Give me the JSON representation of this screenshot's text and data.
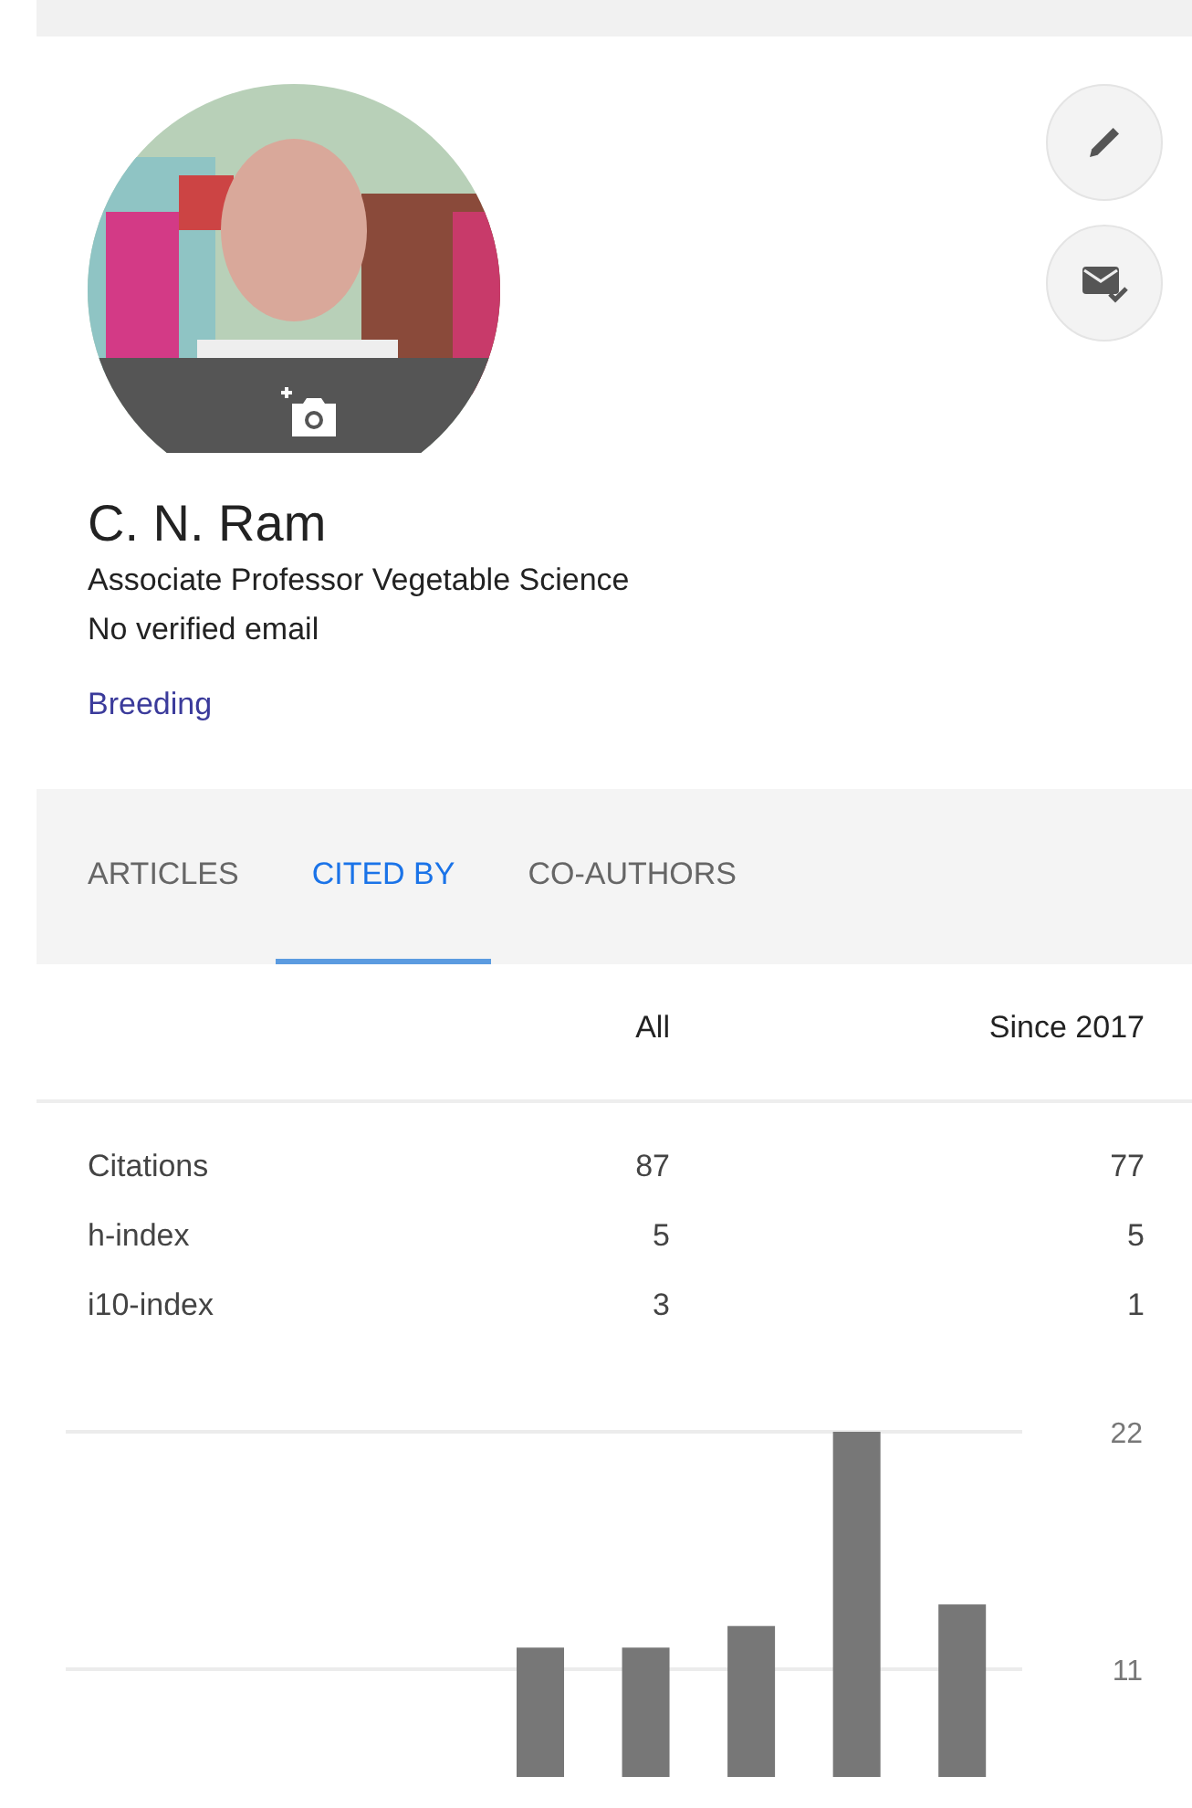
{
  "profile": {
    "name": "C. N. Ram",
    "affiliation": "Associate Professor Vegetable Science",
    "email_status": "No verified email",
    "interests": [
      "Breeding"
    ]
  },
  "tabs": [
    {
      "label": "ARTICLES",
      "selected": false
    },
    {
      "label": "CITED BY",
      "selected": true
    },
    {
      "label": "CO-AUTHORS",
      "selected": false
    }
  ],
  "citations": {
    "columns": [
      "All",
      "Since 2017"
    ],
    "rows": [
      {
        "label": "Citations",
        "all": "87",
        "since": "77"
      },
      {
        "label": "h-index",
        "all": "5",
        "since": "5"
      },
      {
        "label": "i10-index",
        "all": "3",
        "since": "1"
      }
    ],
    "chart_data": {
      "type": "bar",
      "values": [
        null,
        null,
        null,
        null,
        12,
        12,
        13,
        22,
        14
      ],
      "ylim": [
        6,
        22
      ],
      "yticks": [
        11,
        22
      ]
    }
  }
}
